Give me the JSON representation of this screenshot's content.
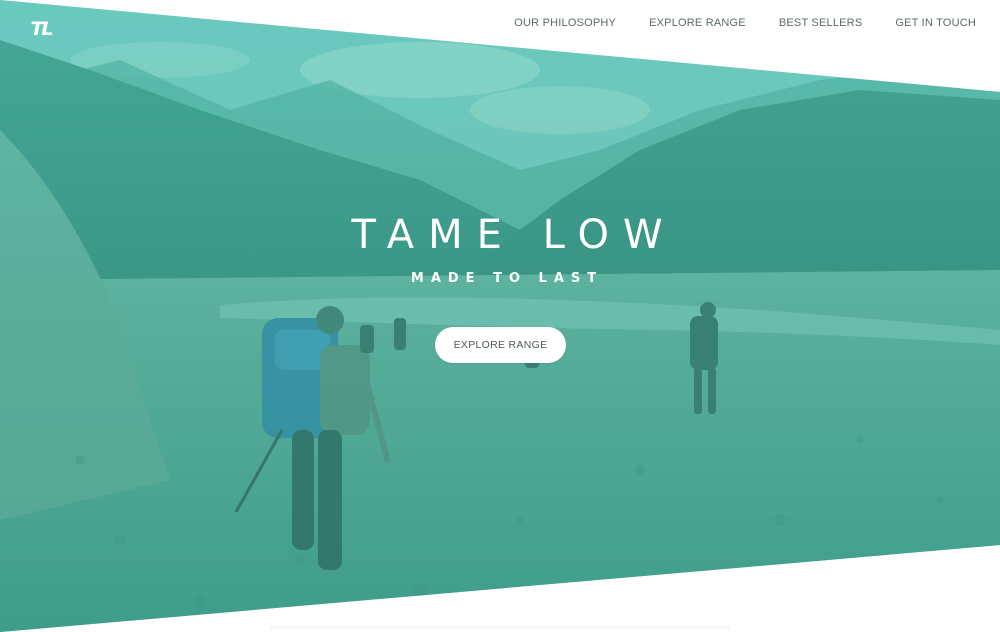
{
  "logo": {
    "text": "TL"
  },
  "nav": {
    "items": [
      {
        "label": "OUR PHILOSOPHY"
      },
      {
        "label": "EXPLORE RANGE"
      },
      {
        "label": "BEST SELLERS"
      },
      {
        "label": "GET IN TOUCH"
      }
    ]
  },
  "hero": {
    "title": "TAME LOW",
    "subtitle": "MADE TO LAST",
    "cta_label": "EXPLORE RANGE"
  },
  "colors": {
    "tint": "#58c4b4",
    "nav_text": "#5b6b6a",
    "button_bg": "#ffffff",
    "button_text": "#4d5a59"
  }
}
